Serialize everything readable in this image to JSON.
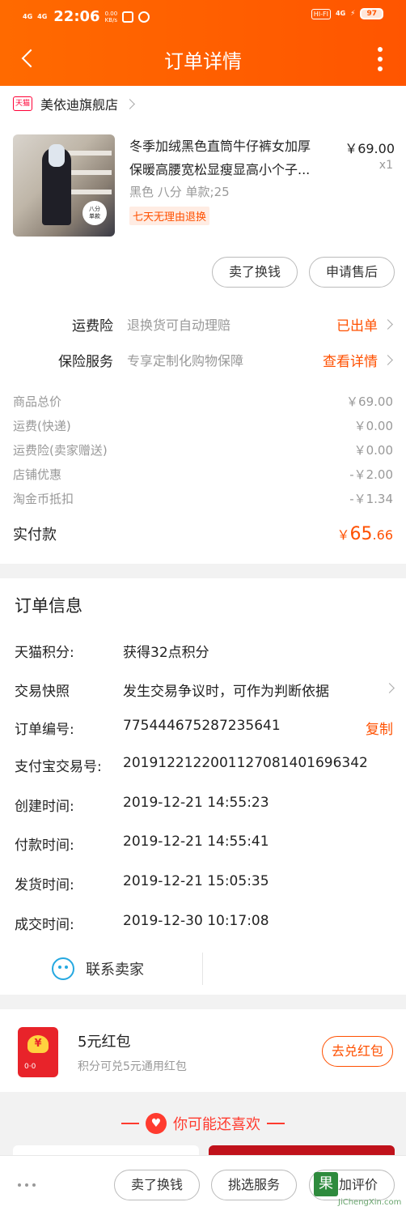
{
  "status_bar": {
    "net1": "4G",
    "net2": "4G",
    "time": "22:06",
    "speed_value": "0.00",
    "speed_unit": "KB/s",
    "hifi": "HI-FI",
    "net3": "4G",
    "battery": "97"
  },
  "header": {
    "title": "订单详情"
  },
  "shop": {
    "badge": "天猫",
    "name": "美依迪旗舰店"
  },
  "product": {
    "title_line1": "冬季加绒黑色直筒牛仔裤女加厚",
    "title_line2": "保暖高腰宽松显瘦显高小个子...",
    "price": "￥69.00",
    "qty": "x1",
    "sku": "黑色 八分 单款;25",
    "return_tag": "七天无理由退换",
    "image_tag_line1": "八分",
    "image_tag_line2": "单款"
  },
  "actions": {
    "sell": "卖了换钱",
    "after_sale": "申请售后"
  },
  "services": [
    {
      "label": "运费险",
      "desc": "退换货可自动理赔",
      "link": "已出单"
    },
    {
      "label": "保险服务",
      "desc": "专享定制化购物保障",
      "link": "查看详情"
    }
  ],
  "fees": [
    {
      "label": "商品总价",
      "value": "￥69.00"
    },
    {
      "label": "运费(快递)",
      "value": "￥0.00"
    },
    {
      "label": "运费险(卖家赠送)",
      "value": "￥0.00"
    },
    {
      "label": "店铺优惠",
      "value": "-￥2.00"
    },
    {
      "label": "淘金币抵扣",
      "value": "-￥1.34"
    }
  ],
  "paid": {
    "label": "实付款",
    "currency": "￥",
    "integer": "65",
    "decimal": ".66"
  },
  "order_info": {
    "title": "订单信息",
    "rows": [
      {
        "key": "天猫积分:",
        "value": "获得32点积分"
      },
      {
        "key": "交易快照",
        "value": "发生交易争议时，可作为判断依据"
      },
      {
        "key": "订单编号:",
        "value": "775444675287235641",
        "action": "复制"
      },
      {
        "key": "支付宝交易号:",
        "value": "2019122122001127081401696342"
      },
      {
        "key": "创建时间:",
        "value": "2019-12-21 14:55:23"
      },
      {
        "key": "付款时间:",
        "value": "2019-12-21 14:55:41"
      },
      {
        "key": "发货时间:",
        "value": "2019-12-21 15:05:35"
      },
      {
        "key": "成交时间:",
        "value": "2019-12-30 10:17:08"
      }
    ],
    "contact": "联系卖家"
  },
  "redpack": {
    "title": "5元红包",
    "subtitle": "积分可兑5元通用红包",
    "button": "去兑红包",
    "coin": "¥",
    "bottom": "0·0"
  },
  "recommend": {
    "title": "你可能还喜欢"
  },
  "bottom_bar": {
    "sell": "卖了换钱",
    "pick_service": "挑选服务",
    "review": "追加评价"
  },
  "watermark": {
    "char": "果",
    "text": "JiChengXin.com"
  },
  "colors": {
    "brand": "#ff5500",
    "accent": "#ff5000",
    "tmall": "#ff0036"
  }
}
